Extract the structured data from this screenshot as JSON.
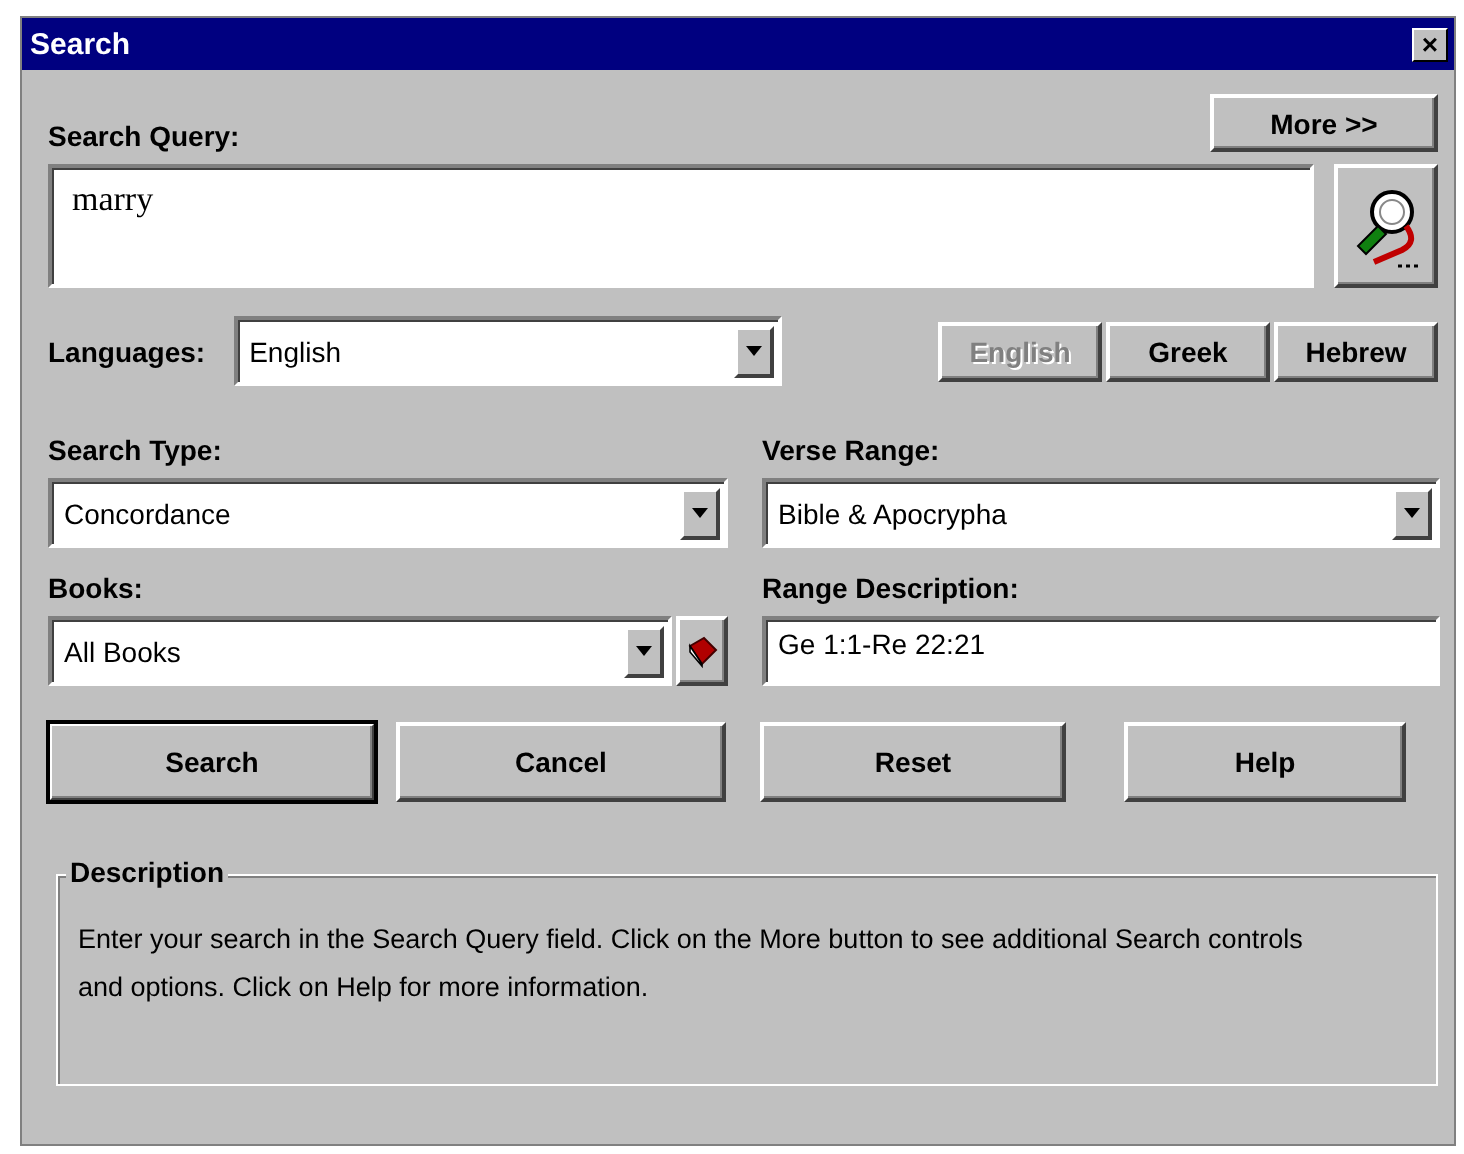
{
  "window": {
    "title": "Search",
    "close": "×"
  },
  "query": {
    "label": "Search Query:",
    "value": "marry",
    "more": "More >>"
  },
  "languages": {
    "label": "Languages:",
    "value": "English",
    "buttons": [
      {
        "label": "English",
        "disabled": true
      },
      {
        "label": "Greek",
        "disabled": false
      },
      {
        "label": "Hebrew",
        "disabled": false
      }
    ]
  },
  "search_type": {
    "label": "Search Type:",
    "value": "Concordance"
  },
  "verse_range": {
    "label": "Verse Range:",
    "value": "Bible & Apocrypha"
  },
  "books": {
    "label": "Books:",
    "value": "All Books"
  },
  "range_description": {
    "label": "Range Description:",
    "value": "Ge 1:1-Re 22:21"
  },
  "buttons": [
    {
      "label": "Search",
      "default": true
    },
    {
      "label": "Cancel",
      "default": false
    },
    {
      "label": "Reset",
      "default": false
    },
    {
      "label": "Help",
      "default": false
    }
  ],
  "description": {
    "title": "Description",
    "text": "Enter your search in the Search Query field. Click on the More button to see additional Search controls and options. Click on Help for more information."
  }
}
